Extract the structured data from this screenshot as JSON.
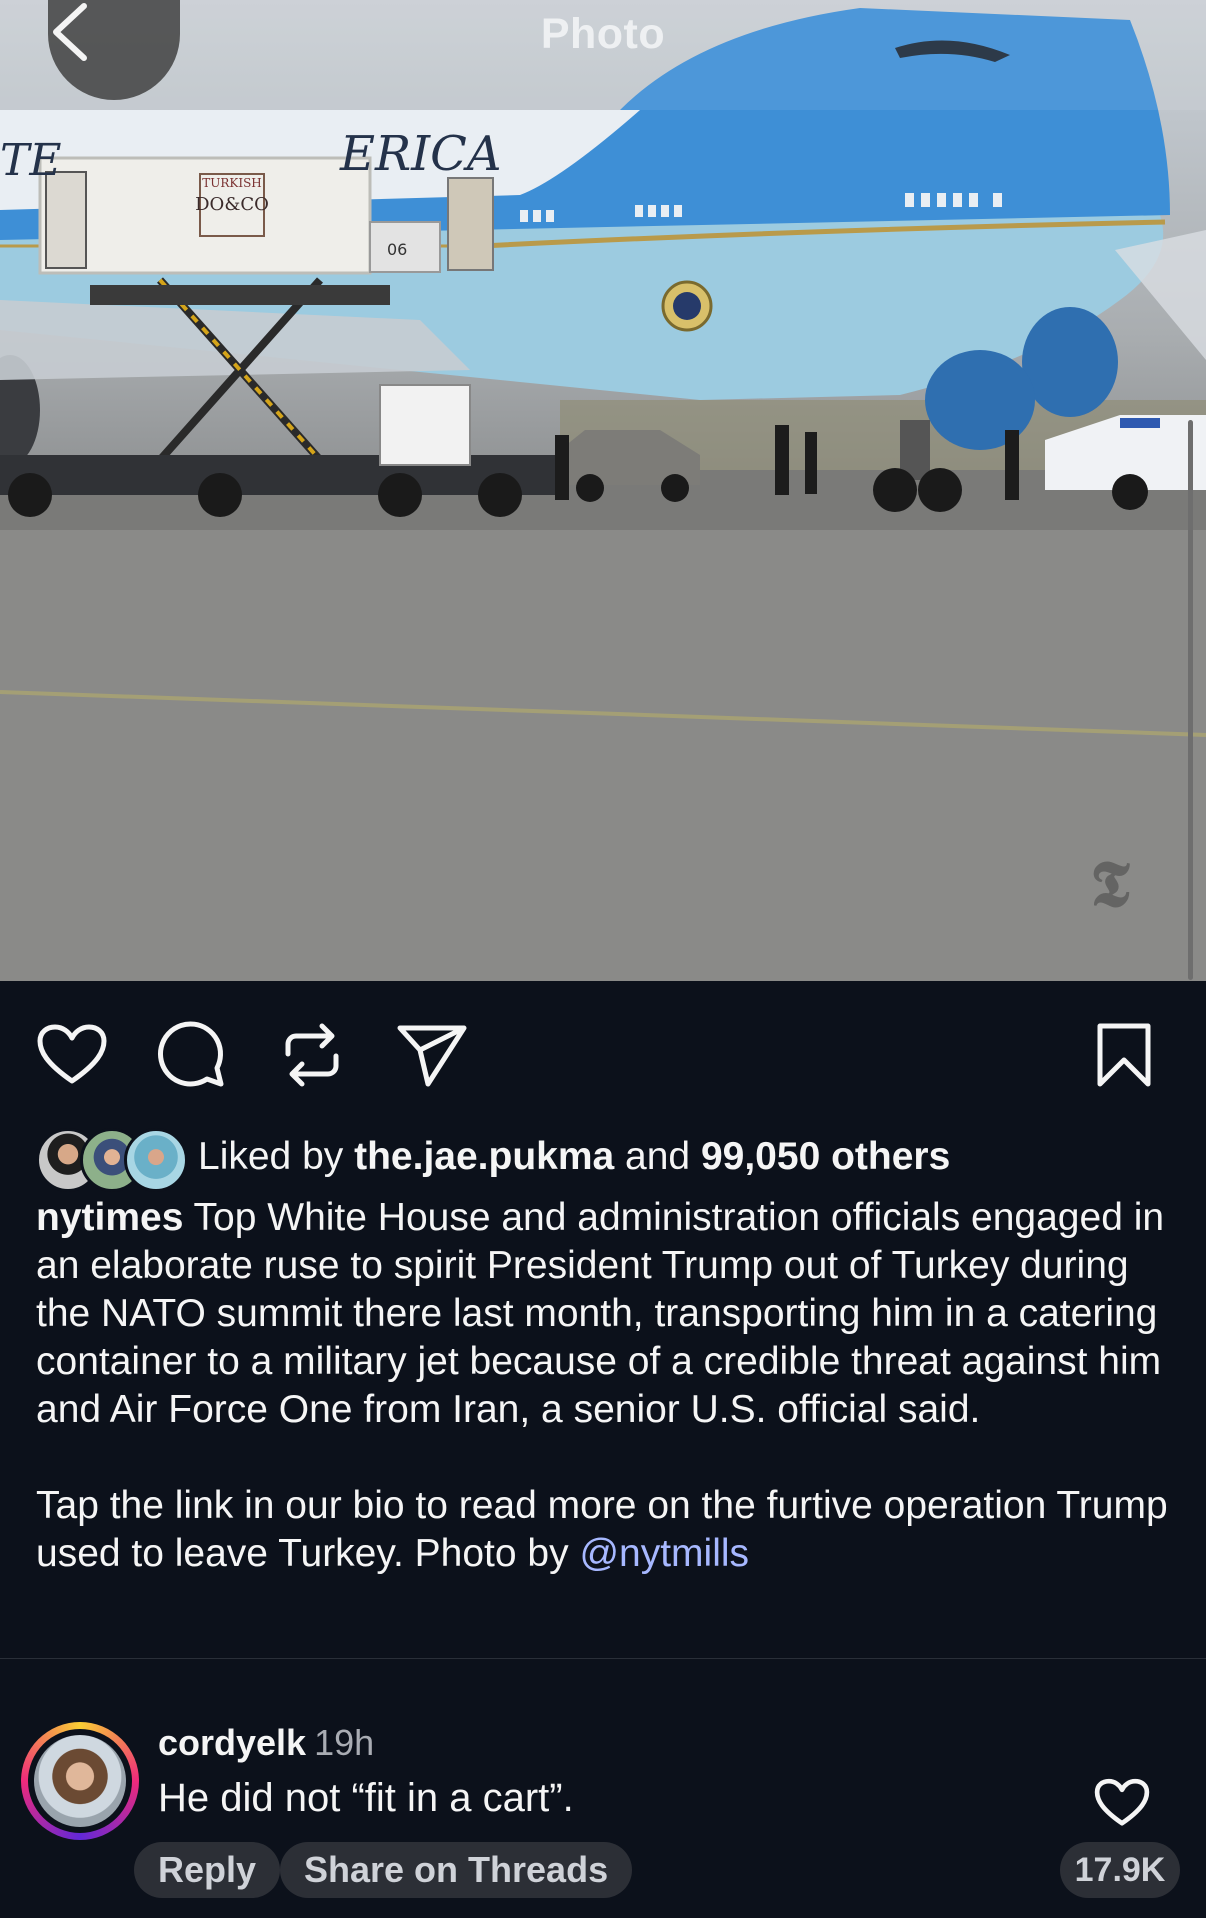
{
  "header": {
    "title": "Photo",
    "back_icon": "chevron-left-icon",
    "watermark_icon": "nyt-logo-icon"
  },
  "actions": {
    "like_icon": "heart-icon",
    "comment_icon": "comment-icon",
    "repost_icon": "repost-icon",
    "share_icon": "send-icon",
    "save_icon": "bookmark-icon"
  },
  "likes": {
    "prefix": "Liked by",
    "user": "the.jae.pukma",
    "conjunction": "and",
    "others": "99,050 others"
  },
  "caption": {
    "username": "nytimes",
    "text": "Top White House and administration officials engaged in an elaborate ruse to spirit President Trump out of Turkey during the NATO summit there last month, transporting him in a catering container to a military jet because of a credible threat against him and Air Force One from Iran, a senior U.S. official said.",
    "text2": "Tap the link in our bio to read more on the furtive operation Trump used to leave Turkey. Photo by",
    "mention": "@nytmills"
  },
  "comment": {
    "username": "cordyelk",
    "time": "19h",
    "text": "He did not “fit in a cart”.",
    "reply_label": "Reply",
    "share_label": "Share on Threads",
    "like_count": "17.9K"
  },
  "colors": {
    "background": "#0c111b",
    "mention": "#a7b8ff",
    "plane_blue": "#3e8fd6"
  }
}
